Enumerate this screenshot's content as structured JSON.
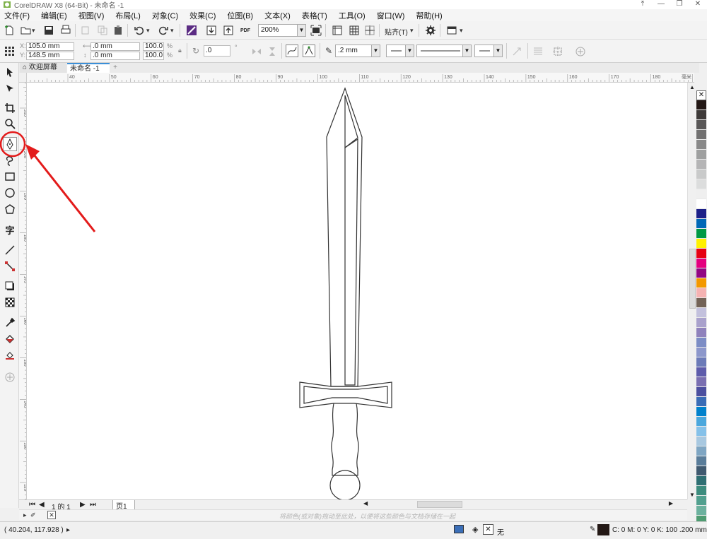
{
  "window": {
    "title": "CorelDRAW X8 (64-Bit) - 未命名 -1",
    "controls": [
      "⤒",
      "—",
      "❐",
      "✕"
    ]
  },
  "menu": [
    "文件(F)",
    "编辑(E)",
    "视图(V)",
    "布局(L)",
    "对象(C)",
    "效果(C)",
    "位图(B)",
    "文本(X)",
    "表格(T)",
    "工具(O)",
    "窗口(W)",
    "帮助(H)"
  ],
  "toolbar": {
    "zoom": "200%",
    "snap_label": "贴齐(T)",
    "pdf_label": "PDF"
  },
  "properties": {
    "x": "105.0 mm",
    "y": "148.5 mm",
    "width": ".0 mm",
    "height": ".0 mm",
    "scale_x": "100.0",
    "scale_y": "100.0",
    "percent": "%",
    "rotation": ".0",
    "outline_width": ".2 mm"
  },
  "tabs": {
    "home": "欢迎屏幕",
    "document": "未命名 -1",
    "add": "+"
  },
  "ruler": {
    "h_labels": [
      "40",
      "50",
      "60",
      "70",
      "80",
      "90",
      "100",
      "110",
      "120",
      "130",
      "140",
      "150",
      "160",
      "170",
      "180"
    ],
    "units": "毫米",
    "v_labels": [
      "210",
      "200",
      "190",
      "180",
      "170",
      "160",
      "150",
      "140",
      "130",
      "120"
    ]
  },
  "palette": {
    "no_color": "✕",
    "colors": [
      "#231815",
      "#3e3a39",
      "#595757",
      "#727171",
      "#898989",
      "#9fa0a0",
      "#b5b5b6",
      "#c9caca",
      "#dcdddd",
      "#efefef",
      "#ffffff",
      "#1d2088",
      "#0068b7",
      "#009944",
      "#fff100",
      "#e60012",
      "#e4007f",
      "#920783",
      "#f39800",
      "#f5b2b2",
      "#736357",
      "#c3c1dd",
      "#a9a1cc",
      "#8f82bc",
      "#7c8dc5",
      "#8c97cb",
      "#6c7bb8",
      "#5e5cab",
      "#7a6fb1",
      "#4c4f9f",
      "#3a6cb6",
      "#0081cc",
      "#4aa7dd",
      "#85c1e9",
      "#a8c8e0",
      "#7fa6c3",
      "#5a7d9a",
      "#405a70",
      "#2f6f73",
      "#3d8c7e",
      "#52a08f",
      "#6cb19e",
      "#4f9c72",
      "#3e9ea8",
      "#62b6c5",
      "#8ed0dc"
    ]
  },
  "pagebar": {
    "page_info": "1 的 1",
    "page_tab": "页1"
  },
  "hint": "将颜色(或对象)拖动至此处，以便将这些颜色与文档存储在一起",
  "status": {
    "coords": "( 40.204, 117.928 )",
    "fill_label": "无",
    "outline_info": "C: 0 M: 0 Y: 0 K: 100  .200 mm"
  }
}
